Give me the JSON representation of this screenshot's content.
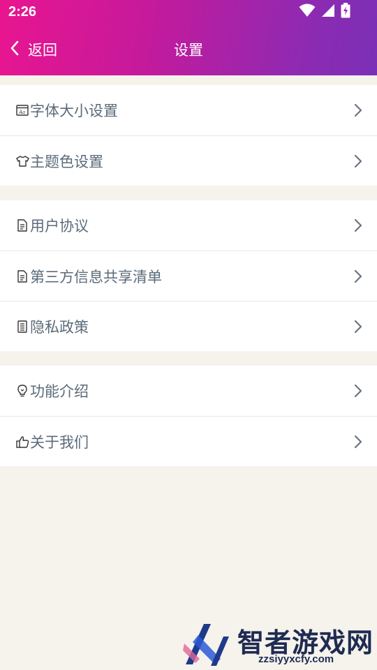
{
  "status_bar": {
    "time": "2:26",
    "icons": [
      "wifi-icon",
      "signal-icon",
      "battery-charging-icon"
    ]
  },
  "nav": {
    "back_label": "返回",
    "title": "设置"
  },
  "groups": [
    {
      "items": [
        {
          "label": "字体大小设置",
          "icon": "font-size-icon"
        },
        {
          "label": "主题色设置",
          "icon": "tshirt-icon"
        }
      ]
    },
    {
      "items": [
        {
          "label": "用户协议",
          "icon": "document-icon"
        },
        {
          "label": "第三方信息共享清单",
          "icon": "document-icon"
        },
        {
          "label": "隐私政策",
          "icon": "list-document-icon"
        }
      ]
    },
    {
      "items": [
        {
          "label": "功能介绍",
          "icon": "lightbulb-icon"
        },
        {
          "label": "关于我们",
          "icon": "thumbs-up-icon"
        }
      ]
    }
  ],
  "watermark": {
    "brand": "智者游戏网",
    "url": "zzsiyyxcfy.com"
  },
  "colors": {
    "header_gradient_start": "#e9158f",
    "header_gradient_end": "#7a30b6",
    "background": "#f6f2ec",
    "row_text": "#5b6b7a"
  }
}
